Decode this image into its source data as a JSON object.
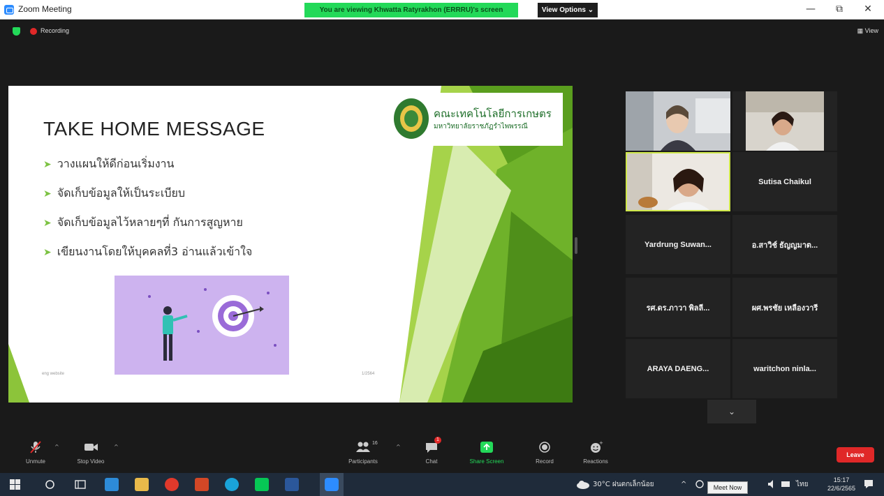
{
  "window": {
    "title": "Zoom Meeting",
    "share_banner": "You are viewing Khwatta Ratyrakhon (ERRRU)'s screen",
    "view_options": "View Options ⌄",
    "controls": {
      "minimize": "—",
      "maximize": "⧉",
      "close": "✕"
    }
  },
  "meeting": {
    "recording_label": "Recording",
    "view_label": "View"
  },
  "slide": {
    "title": "TAKE HOME MESSAGE",
    "bullets": [
      "วางแผนให้ดีก่อนเริ่มงาน",
      "จัดเก็บข้อมูลให้เป็นระเบียบ",
      "จัดเก็บข้อมูลไว้หลายๆที่ กันการสูญหาย",
      "เขียนงานโดยให้บุคคลที่3 อ่านแล้วเข้าใจ"
    ],
    "logo_line1": "คณะเทคโนโลยีการเกษตร",
    "logo_line2": "มหาวิทยาลัยราชภัฏรำไพพรรณี",
    "footer_left": "eng website",
    "footer_center": "1/2564",
    "colors": {
      "green_dark": "#5a9e1e",
      "green_light": "#a6d34a",
      "illustration_bg": "#cdb3ef"
    }
  },
  "gallery": {
    "participants": [
      {
        "name": "",
        "kind": "video"
      },
      {
        "name": "",
        "kind": "video"
      },
      {
        "name": "",
        "kind": "video",
        "active": true
      },
      {
        "name": "Sutisa Chaikul",
        "kind": "name"
      },
      {
        "name": "Yardrung  Suwan...",
        "kind": "name"
      },
      {
        "name": "อ.สาวิช์ ธัญญมาต...",
        "kind": "name"
      },
      {
        "name": "รศ.ดร.ภาวา พิลลี...",
        "kind": "name"
      },
      {
        "name": "ผศ.พรชัย เหลืองวารี",
        "kind": "name"
      },
      {
        "name": "ARAYA  DAENG...",
        "kind": "name"
      },
      {
        "name": "waritchon  ninla...",
        "kind": "name"
      }
    ],
    "expand_icon": "chevron-down-icon"
  },
  "toolbar": {
    "unmute": "Unmute",
    "stop_video": "Stop Video",
    "participants": "Participants",
    "participants_count": "16",
    "chat": "Chat",
    "chat_badge": "1",
    "share_screen": "Share Screen",
    "record": "Record",
    "reactions": "Reactions",
    "leave": "Leave"
  },
  "taskbar": {
    "weather": "30°C  ฝนตกเล็กน้อย",
    "lang": "ไทย",
    "time": "15:17",
    "date": "22/6/2565",
    "tooltip": "Meet Now"
  }
}
